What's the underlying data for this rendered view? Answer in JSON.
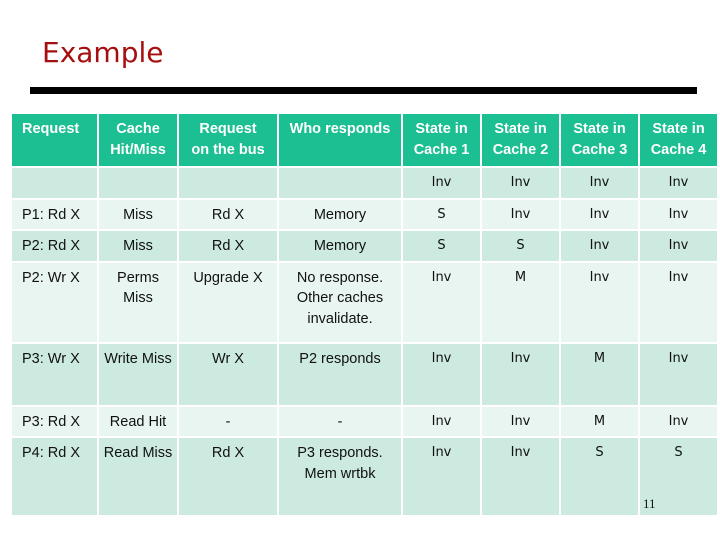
{
  "slide": {
    "title": "Example",
    "page_number": "11"
  },
  "table": {
    "headers": [
      {
        "line1": "Request",
        "line2": ""
      },
      {
        "line1": "Cache",
        "line2": "Hit/Miss"
      },
      {
        "line1": "Request",
        "line2": "on the bus"
      },
      {
        "line1": "Who responds",
        "line2": ""
      },
      {
        "line1": "State in",
        "line2": "Cache 1"
      },
      {
        "line1": "State in",
        "line2": "Cache 2"
      },
      {
        "line1": "State in",
        "line2": "Cache 3"
      },
      {
        "line1": "State in",
        "line2": "Cache 4"
      }
    ],
    "rows": [
      {
        "request": "",
        "hit_miss": "",
        "bus": "",
        "responds": "",
        "c1": "Inv",
        "c2": "Inv",
        "c3": "Inv",
        "c4": "Inv"
      },
      {
        "request": "P1: Rd X",
        "hit_miss": "Miss",
        "bus": "Rd X",
        "responds": "Memory",
        "c1": "S",
        "c2": "Inv",
        "c3": "Inv",
        "c4": "Inv"
      },
      {
        "request": "P2: Rd X",
        "hit_miss": "Miss",
        "bus": "Rd X",
        "responds": "Memory",
        "c1": "S",
        "c2": "S",
        "c3": "Inv",
        "c4": "Inv"
      },
      {
        "request": "P2: Wr X",
        "hit_miss": "Perms Miss",
        "bus": "Upgrade X",
        "responds": "No response. Other caches invalidate.",
        "c1": "Inv",
        "c2": "M",
        "c3": "Inv",
        "c4": "Inv"
      },
      {
        "request": "P3: Wr X",
        "hit_miss": "Write Miss",
        "bus": "Wr X",
        "responds": "P2 responds",
        "c1": "Inv",
        "c2": "Inv",
        "c3": "M",
        "c4": "Inv"
      },
      {
        "request": "P3: Rd X",
        "hit_miss": "Read Hit",
        "bus": "-",
        "responds": "-",
        "c1": "Inv",
        "c2": "Inv",
        "c3": "M",
        "c4": "Inv"
      },
      {
        "request": "P4: Rd X",
        "hit_miss": "Read Miss",
        "bus": "Rd X",
        "responds": "P3 responds. Mem wrtbk",
        "c1": "Inv",
        "c2": "Inv",
        "c3": "S",
        "c4": "S"
      }
    ]
  },
  "colors": {
    "title": "#a50f0f",
    "header_bg": "#1cbf91",
    "row_dark": "#cdeae0",
    "row_light": "#e8f5f0"
  }
}
